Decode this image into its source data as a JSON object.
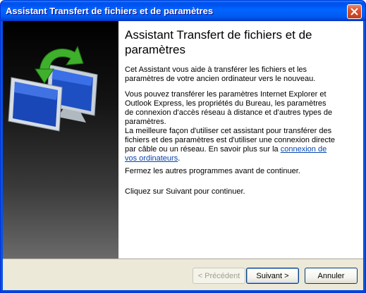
{
  "window": {
    "title": "Assistant Transfert de fichiers et de paramètres"
  },
  "content": {
    "heading": "Assistant Transfert de fichiers et de paramètres",
    "paragraphs": [
      "Cet Assistant vous aide à transférer les fichiers et les paramètres de votre ancien ordinateur vers le nouveau.",
      "Vous pouvez transférer les paramètres Internet Explorer et Outlook Express, les propriétés du Bureau, les paramètres de connexion d'accès réseau à distance et d'autres types de paramètres."
    ],
    "paragraph3_text": "La meilleure façon d'utiliser cet assistant pour transférer des fichiers et des paramètres est d'utiliser une connexion directe par câble ou un réseau. En savoir plus sur la ",
    "paragraph3_link": "connexion de vos ordinateurs",
    "paragraph3_end": ".",
    "paragraph4": "Fermez les autres programmes avant de continuer.",
    "paragraph5": "Cliquez sur Suivant pour continuer."
  },
  "buttons": {
    "back": "< Précédent",
    "next": "Suivant >",
    "cancel": "Annuler"
  },
  "icons": {
    "close": "close-icon",
    "hero": "transfer-computers-icon"
  },
  "colors": {
    "titlebar": "#0054e3",
    "sidebar": "#000000",
    "footer": "#ece9d8",
    "link": "#0645ad"
  }
}
